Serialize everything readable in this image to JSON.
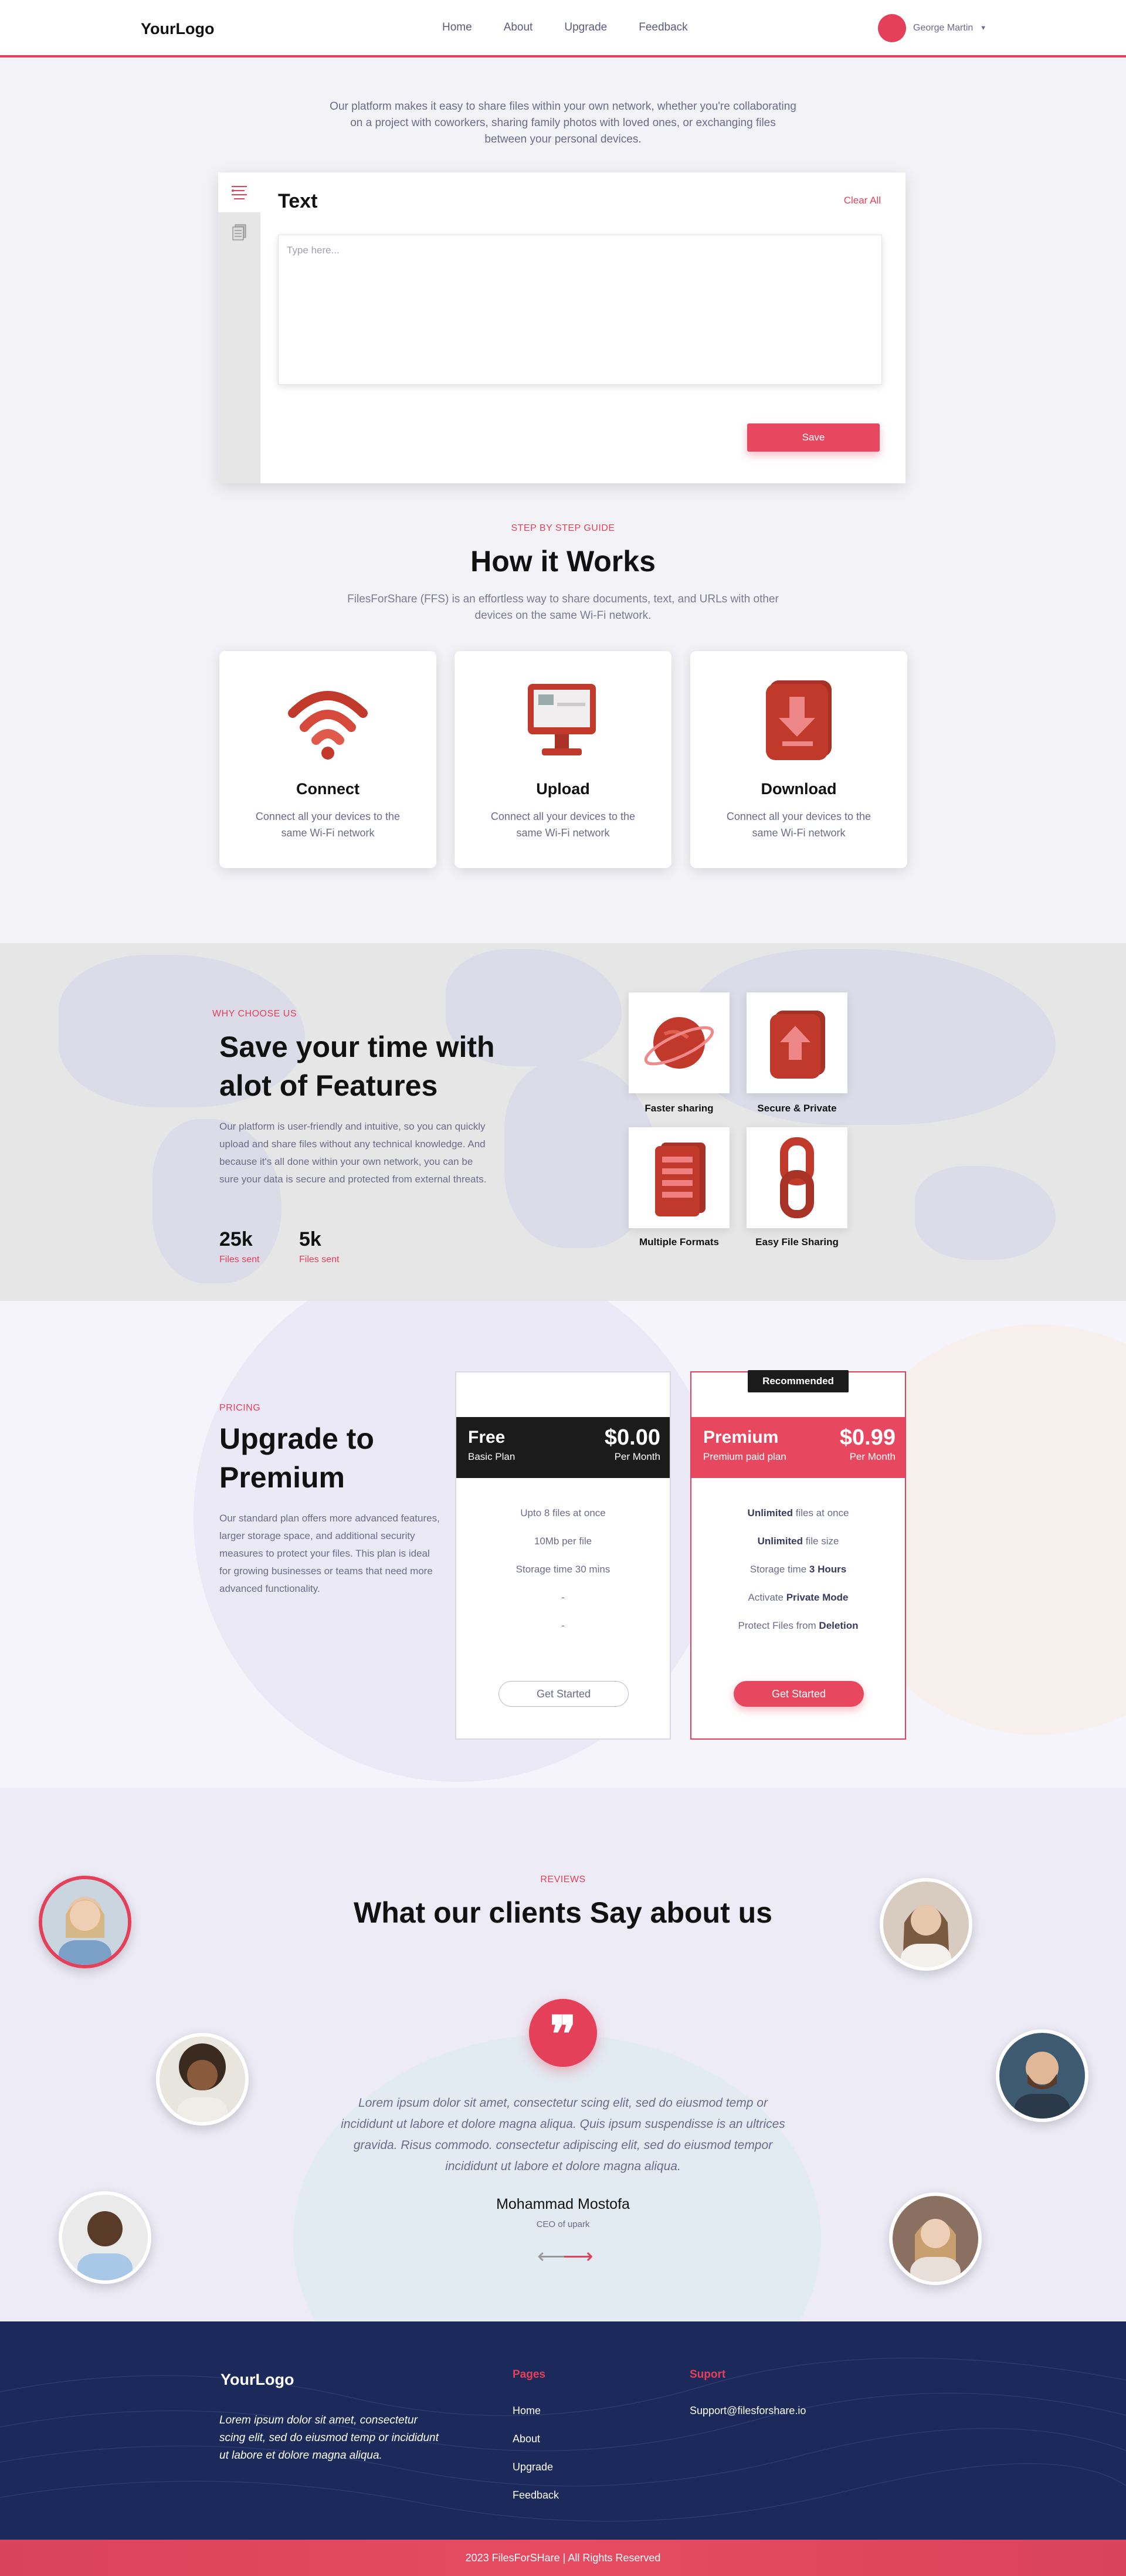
{
  "header": {
    "logo": "YourLogo",
    "nav": [
      "Home",
      "About",
      "Upgrade",
      "Feedback"
    ],
    "user_name": "George Martin"
  },
  "intro": "Our platform makes it easy to share files within your own network, whether you're collaborating on a project with coworkers, sharing family photos with loved ones, or exchanging files between your personal devices.",
  "editor": {
    "title": "Text",
    "clear_label": "Clear All",
    "placeholder": "Type here...",
    "save_label": "Save"
  },
  "how": {
    "eyebrow": "STEP BY STEP GUIDE",
    "title": "How it Works",
    "subtitle": "FilesForShare (FFS) is an effortless way to share documents, text, and URLs with other devices on the same Wi-Fi network.",
    "cards": [
      {
        "title": "Connect",
        "desc": "Connect all your devices to the same Wi-Fi network",
        "icon": "wifi-icon"
      },
      {
        "title": "Upload",
        "desc": "Connect all your devices to the same Wi-Fi network",
        "icon": "monitor-icon"
      },
      {
        "title": "Download",
        "desc": "Connect all your devices to the same Wi-Fi network",
        "icon": "download-icon"
      }
    ]
  },
  "features": {
    "eyebrow": "WHY CHOOSE US",
    "title": "Save your time with alot of Features",
    "desc": "Our platform is user-friendly and intuitive, so you can quickly upload and share files without any technical knowledge. And because it's all done within your own network, you can be sure your data is secure and protected from external threats.",
    "stats": [
      {
        "num": "25k",
        "label": "Files sent"
      },
      {
        "num": "5k",
        "label": "Files sent"
      }
    ],
    "tiles": [
      "Faster sharing",
      "Secure & Private",
      "Multiple Formats",
      "Easy File Sharing"
    ]
  },
  "pricing": {
    "eyebrow": "PRICING",
    "title": "Upgrade to Premium",
    "desc": "Our standard plan offers more advanced features, larger storage space, and additional security measures to protect your files. This plan is ideal for growing businesses or teams that need more advanced functionality.",
    "free": {
      "name": "Free",
      "sub": "Basic Plan",
      "price": "$0.00",
      "per": "Per Month",
      "features": [
        "Upto 8 files at once",
        "10Mb per file",
        "Storage time 30 mins",
        "-",
        "-"
      ],
      "cta": "Get Started"
    },
    "premium": {
      "badge": "Recommended",
      "name": "Premium",
      "sub": "Premium paid plan",
      "price": "$0.99",
      "per": "Per Month",
      "features": [
        {
          "bold": "Unlimited",
          "rest": " files at once"
        },
        {
          "bold": "Unlimited",
          "rest": " file size"
        },
        {
          "pre": "Storage time ",
          "bold": "3 Hours"
        },
        {
          "pre": "Activate ",
          "bold": "Private Mode"
        },
        {
          "pre": "Protect Files from ",
          "bold": "Deletion"
        }
      ],
      "cta": "Get Started"
    }
  },
  "reviews": {
    "eyebrow": "REVIEWS",
    "title": "What our clients Say about us",
    "quote": "Lorem ipsum dolor sit amet, consectetur scing elit, sed do eiusmod temp or incididunt ut labore et dolore magna aliqua. Quis ipsum suspendisse is an ultrices gravida. Risus commodo. consectetur adipiscing elit, sed do eiusmod tempor incididunt ut labore et dolore magna aliqua.",
    "name": "Mohammad Mostofa",
    "role": "CEO of upark"
  },
  "footer": {
    "logo": "YourLogo",
    "text": "Lorem ipsum dolor sit amet, consectetur scing elit, sed do eiusmod temp or incididunt ut labore et dolore magna aliqua.",
    "pages_head": "Pages",
    "pages": [
      "Home",
      "About",
      "Upgrade",
      "Feedback"
    ],
    "support_head": "Suport",
    "support_email": "Support@filesforshare.io",
    "copyright": "2023 FilesForSHare | All Rights Reserved"
  },
  "colors": {
    "accent": "#e4405a",
    "footer": "#1b2a5a",
    "dark": "#1b1b1b"
  }
}
